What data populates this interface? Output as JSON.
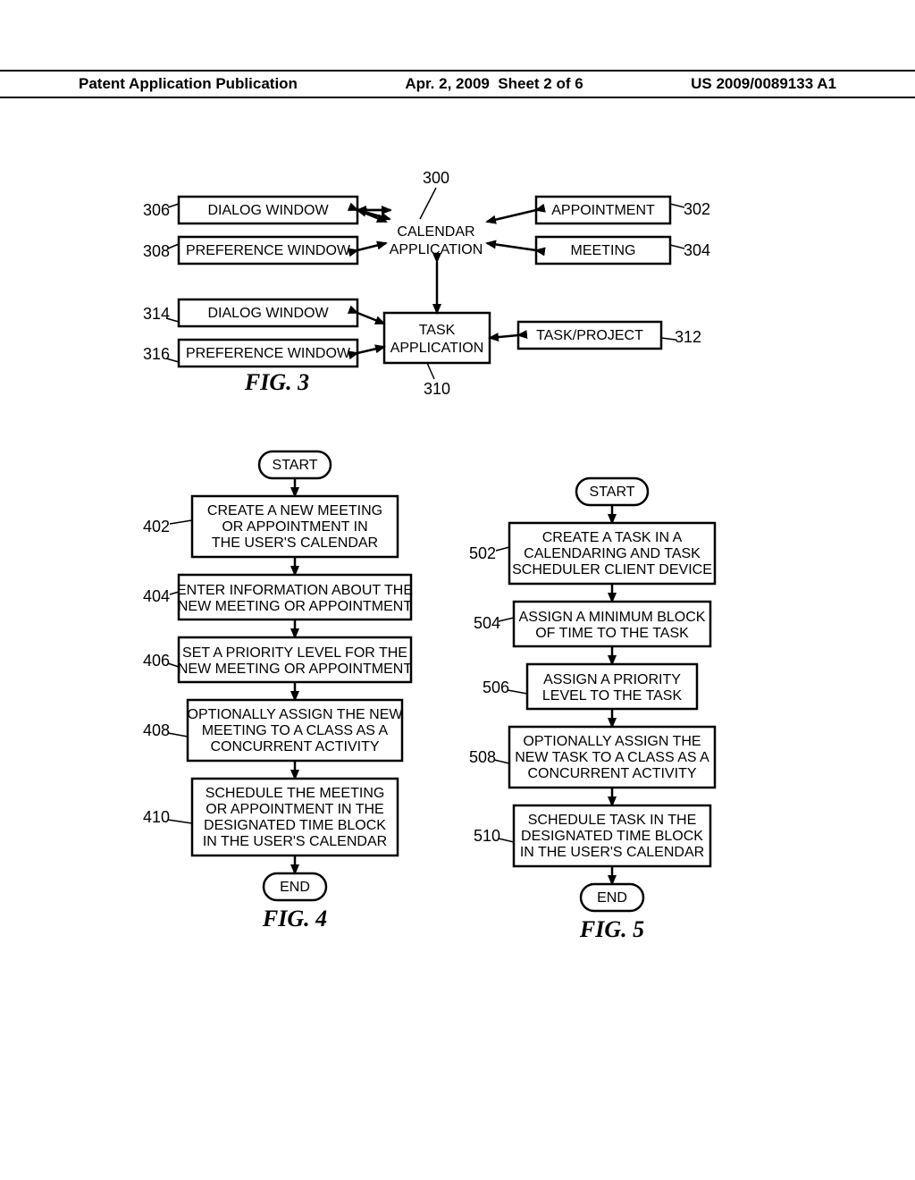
{
  "header": {
    "left": "Patent Application Publication",
    "center": "Apr. 2, 2009  Sheet 2 of 6",
    "right": "US 2009/0089133 A1"
  },
  "fig3": {
    "ref_300": "300",
    "ref_302": "302",
    "ref_304": "304",
    "ref_306": "306",
    "ref_308": "308",
    "ref_310": "310",
    "ref_312": "312",
    "ref_314": "314",
    "ref_316": "316",
    "calendar_app_l1": "CALENDAR",
    "calendar_app_l2": "APPLICATION",
    "task_app_l1": "TASK",
    "task_app_l2": "APPLICATION",
    "dialog_window_1": "DIALOG WINDOW",
    "preference_window_1": "PREFERENCE WINDOW",
    "dialog_window_2": "DIALOG WINDOW",
    "preference_window_2": "PREFERENCE WINDOW",
    "appointment": "APPOINTMENT",
    "meeting": "MEETING",
    "task_project": "TASK/PROJECT",
    "caption": "FIG. 3"
  },
  "fig4": {
    "start": "START",
    "end": "END",
    "ref_402": "402",
    "ref_404": "404",
    "ref_406": "406",
    "ref_408": "408",
    "ref_410": "410",
    "step_402_l1": "CREATE A NEW MEETING",
    "step_402_l2": "OR APPOINTMENT IN",
    "step_402_l3": "THE USER'S CALENDAR",
    "step_404_l1": "ENTER INFORMATION ABOUT THE",
    "step_404_l2": "NEW MEETING OR APPOINTMENT",
    "step_406_l1": "SET A PRIORITY LEVEL FOR THE",
    "step_406_l2": "NEW MEETING OR APPOINTMENT",
    "step_408_l1": "OPTIONALLY ASSIGN THE NEW",
    "step_408_l2": "MEETING TO A CLASS AS A",
    "step_408_l3": "CONCURRENT ACTIVITY",
    "step_410_l1": "SCHEDULE THE MEETING",
    "step_410_l2": "OR APPOINTMENT IN THE",
    "step_410_l3": "DESIGNATED TIME BLOCK",
    "step_410_l4": "IN THE USER'S CALENDAR",
    "caption": "FIG. 4"
  },
  "fig5": {
    "start": "START",
    "end": "END",
    "ref_502": "502",
    "ref_504": "504",
    "ref_506": "506",
    "ref_508": "508",
    "ref_510": "510",
    "step_502_l1": "CREATE A TASK IN A",
    "step_502_l2": "CALENDARING AND TASK",
    "step_502_l3": "SCHEDULER CLIENT DEVICE",
    "step_504_l1": "ASSIGN A MINIMUM BLOCK",
    "step_504_l2": "OF TIME TO THE TASK",
    "step_506_l1": "ASSIGN A PRIORITY",
    "step_506_l2": "LEVEL TO THE TASK",
    "step_508_l1": "OPTIONALLY ASSIGN THE",
    "step_508_l2": "NEW TASK TO A CLASS AS A",
    "step_508_l3": "CONCURRENT ACTIVITY",
    "step_510_l1": "SCHEDULE TASK IN THE",
    "step_510_l2": "DESIGNATED TIME BLOCK",
    "step_510_l3": "IN THE USER'S CALENDAR",
    "caption": "FIG. 5"
  }
}
